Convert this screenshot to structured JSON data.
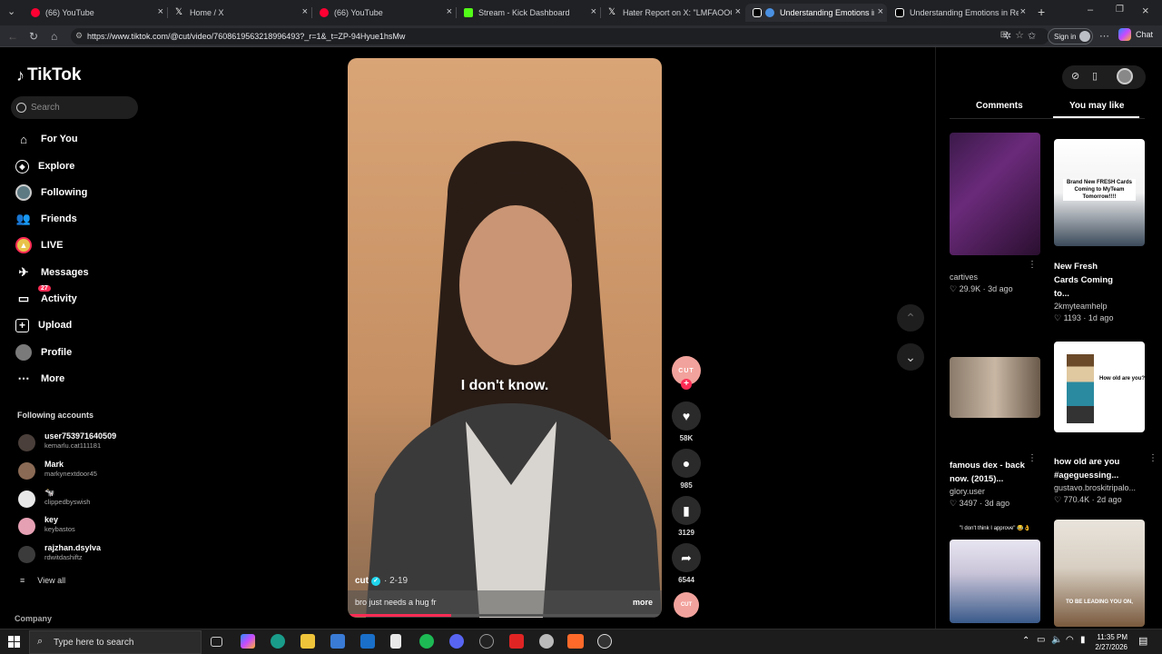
{
  "browser": {
    "tabs": [
      {
        "title": "(66) YouTube",
        "color": "#ff0033"
      },
      {
        "title": "Home / X",
        "color": "#ffffff"
      },
      {
        "title": "(66) YouTube",
        "color": "#ff0033"
      },
      {
        "title": "Stream - Kick Dashboard",
        "color": "#53fc18"
      },
      {
        "title": "Hater Report on X: \"LMFAOOO Le",
        "color": "#ffffff"
      },
      {
        "title": "Understanding Emotions in R",
        "color": "#4a90e2"
      },
      {
        "title": "Understanding Emotions in Relati",
        "color": "#ffffff"
      }
    ],
    "new_tab": "+",
    "url": "https://www.tiktok.com/@cut/video/7608619563218996493?_r=1&_t=ZP-94Hyue1hsMw",
    "sign_in": "Sign in",
    "chat": "Chat"
  },
  "sidebar": {
    "logo": "TikTok",
    "search_placeholder": "Search",
    "nav": [
      {
        "label": "For You",
        "icon": "home-icon"
      },
      {
        "label": "Explore",
        "icon": "compass-icon"
      },
      {
        "label": "Following",
        "icon": "following-avatar-icon"
      },
      {
        "label": "Friends",
        "icon": "friends-icon"
      },
      {
        "label": "LIVE",
        "icon": "live-icon"
      },
      {
        "label": "Messages",
        "icon": "messages-icon"
      },
      {
        "label": "Activity",
        "icon": "activity-icon",
        "badge": "27"
      },
      {
        "label": "Upload",
        "icon": "upload-icon"
      },
      {
        "label": "Profile",
        "icon": "profile-icon"
      },
      {
        "label": "More",
        "icon": "more-icon"
      }
    ],
    "following_heading": "Following accounts",
    "accounts": [
      {
        "name": "user753971640509",
        "handle": "kemarlu.cat111181"
      },
      {
        "name": "Mark",
        "handle": "markynextdoor45"
      },
      {
        "name": "🐄",
        "handle": "clippedbyswish"
      },
      {
        "name": "key",
        "handle": "keybastos"
      },
      {
        "name": "rajzhan.dsylva",
        "handle": "rdwitdashiftz"
      }
    ],
    "view_all": "View all",
    "company": "Company"
  },
  "video": {
    "subtitle": "I don't know.",
    "author": "cut",
    "date": "· 2-19",
    "caption": "bro just needs a hug fr",
    "more": "more",
    "progress": 0.33
  },
  "actions": {
    "avatar_text": "CUT",
    "likes": "58K",
    "comments": "985",
    "saves": "3129",
    "shares": "6544",
    "sound_text": "CUT"
  },
  "right_panel": {
    "tabs": [
      "Comments",
      "You may like"
    ],
    "recommendations": [
      {
        "title": "",
        "author": "cartives",
        "stats": "♡ 29.9K · 3d ago"
      },
      {
        "title": "New Fresh Cards Coming to...",
        "author": "2kmyteamhelp",
        "stats": "♡ 1193 · 1d ago",
        "thumb_text": "Brand New FRESH Cards Coming to MyTeam Tomorrow!!!!"
      },
      {
        "title": "famous dex - back now. (2015)...",
        "author": "glory.user",
        "stats": "♡ 3497 · 3d ago"
      },
      {
        "title": "how old are you #ageguessing...",
        "author": "gustavo.broskitripalo...",
        "stats": "♡ 770.4K · 2d ago",
        "thumb_text": "How old are you?"
      },
      {
        "title": "",
        "author": "",
        "stats": "",
        "thumb_text": "\"I don't think I approve\" 😂👌"
      },
      {
        "title": "",
        "author": "",
        "stats": "",
        "thumb_text": "TO BE LEADING YOU ON,"
      }
    ]
  },
  "taskbar": {
    "search_placeholder": "Type here to search",
    "time": "11:35 PM",
    "date": "2/27/2026"
  }
}
